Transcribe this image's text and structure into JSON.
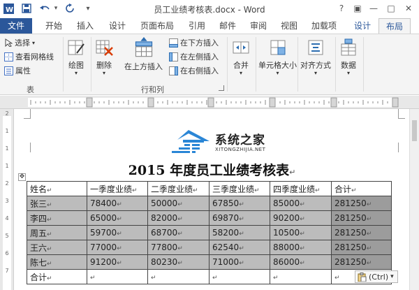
{
  "window": {
    "title": "员工业绩考核表.docx - Word",
    "controls": {
      "help": "?",
      "ribbon_display": "▣",
      "minimize": "—",
      "maximize": "□",
      "close": "✕"
    }
  },
  "qat": {
    "word_icon": "W",
    "save": "save-icon",
    "undo": "undo-icon",
    "redo": "redo-icon",
    "more": "▾"
  },
  "tabs": [
    "文件",
    "开始",
    "插入",
    "设计",
    "页面布局",
    "引用",
    "邮件",
    "审阅",
    "视图",
    "加载项",
    "设计",
    "布局"
  ],
  "ribbon": {
    "table_group": {
      "select": "选择",
      "view_gridlines": "查看网格线",
      "properties": "属性",
      "label": "表"
    },
    "draw": "绘图",
    "delete": "删除",
    "insert_above": "在上方插入",
    "insert_below": "在下方插入",
    "insert_left": "在左侧插入",
    "insert_right": "在右侧插入",
    "rows_cols_label": "行和列",
    "merge": "合并",
    "cell_size": "单元格大小",
    "alignment": "对齐方式",
    "data": "数据"
  },
  "ruler": {
    "vertical_numbers": [
      "2",
      "1",
      "1",
      "1",
      "2",
      "3",
      "4",
      "5",
      "6",
      "7"
    ]
  },
  "watermark": {
    "main": "系统之家",
    "sub": "XITONGZHIJIA.NET"
  },
  "document": {
    "heading": "2015 年度员工业绩考核表",
    "paragraph_mark": "↵",
    "table": {
      "headers": [
        "姓名",
        "一季度业绩",
        "二季度业绩",
        "三季度业绩",
        "四季度业绩",
        "合计"
      ],
      "rows": [
        [
          "张三",
          "78400",
          "50000",
          "67850",
          "85000",
          "281250"
        ],
        [
          "李四",
          "65000",
          "82000",
          "69870",
          "90200",
          "281250"
        ],
        [
          "周五",
          "59700",
          "68700",
          "58200",
          "10500",
          "281250"
        ],
        [
          "王六",
          "77000",
          "77800",
          "62540",
          "88000",
          "281250"
        ],
        [
          "陈七",
          "91200",
          "80230",
          "71000",
          "86000",
          "281250"
        ]
      ],
      "footer": [
        "合计",
        "",
        "",
        "",
        "",
        ""
      ]
    }
  },
  "paste_options": {
    "label": "(Ctrl)",
    "arrow": "▾"
  },
  "colors": {
    "accent": "#2b579a",
    "selection": "#bcbcbc",
    "selection_dark": "#9c9c9c",
    "ribbon_bg": "#f4f4f4"
  }
}
